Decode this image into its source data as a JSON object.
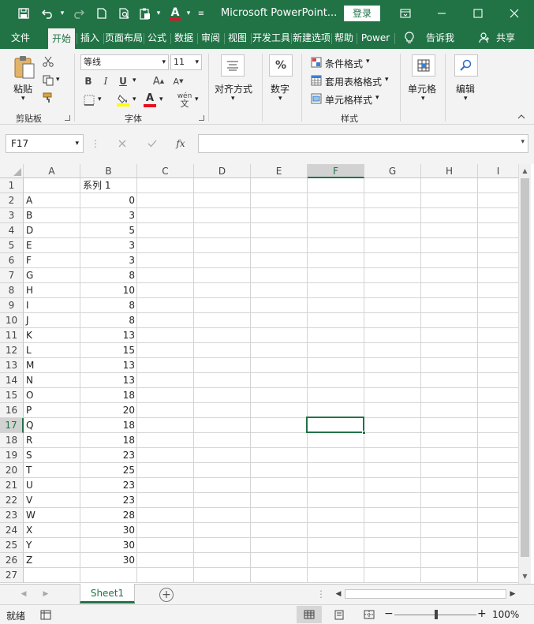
{
  "title_bar": {
    "title": "Microsoft PowerPoint...",
    "login": "登录",
    "qat_icons": [
      "save-icon",
      "undo-icon",
      "redo-icon",
      "new-doc-icon",
      "print-preview-icon",
      "paste-icon",
      "font-color-icon",
      "customize-icon"
    ],
    "window_icons": [
      "ribbon-display-icon",
      "minimize-icon",
      "maximize-icon",
      "close-icon"
    ]
  },
  "tabs": {
    "items": [
      "文件",
      "开始",
      "插入",
      "页面布局",
      "公式",
      "数据",
      "审阅",
      "视图",
      "开发工具",
      "新建选项卡",
      "帮助",
      "Power"
    ],
    "active": "开始",
    "tell_me": "告诉我",
    "share": "共享"
  },
  "ribbon": {
    "clipboard": {
      "paste": "粘贴",
      "label": "剪贴板"
    },
    "font": {
      "name": "等线",
      "size": "11",
      "bold": "B",
      "italic": "I",
      "underline": "U",
      "grow": "A",
      "shrink": "A",
      "wen": "wén",
      "font_color_letter": "A",
      "label": "字体"
    },
    "alignment": {
      "label": "对齐方式"
    },
    "number": {
      "label": "数字",
      "symbol": "%"
    },
    "styles": {
      "conditional": "条件格式",
      "table_format": "套用表格格式",
      "cell_style": "单元格样式",
      "label": "样式"
    },
    "cells": {
      "label": "单元格"
    },
    "editing": {
      "label": "编辑"
    }
  },
  "formula_bar": {
    "name_box": "F17",
    "fx": "fx",
    "content": ""
  },
  "grid": {
    "columns": [
      "A",
      "B",
      "C",
      "D",
      "E",
      "F",
      "G",
      "H",
      "I"
    ],
    "selected_column": "F",
    "selected_row": 17,
    "active_cell": "F17",
    "header_b1": "系列 1",
    "rows": [
      [
        "A",
        "0"
      ],
      [
        "B",
        "3"
      ],
      [
        "D",
        "5"
      ],
      [
        "E",
        "3"
      ],
      [
        "F",
        "3"
      ],
      [
        "G",
        "8"
      ],
      [
        "H",
        "10"
      ],
      [
        "I",
        "8"
      ],
      [
        "J",
        "8"
      ],
      [
        "K",
        "13"
      ],
      [
        "L",
        "15"
      ],
      [
        "M",
        "13"
      ],
      [
        "N",
        "13"
      ],
      [
        "O",
        "18"
      ],
      [
        "P",
        "20"
      ],
      [
        "Q",
        "18"
      ],
      [
        "R",
        "18"
      ],
      [
        "S",
        "23"
      ],
      [
        "T",
        "25"
      ],
      [
        "U",
        "23"
      ],
      [
        "V",
        "23"
      ],
      [
        "W",
        "28"
      ],
      [
        "X",
        "30"
      ],
      [
        "Y",
        "30"
      ],
      [
        "Z",
        "30"
      ]
    ],
    "row_numbers": [
      "1",
      "2",
      "3",
      "4",
      "5",
      "6",
      "7",
      "8",
      "9",
      "10",
      "11",
      "12",
      "13",
      "14",
      "15",
      "16",
      "17",
      "18",
      "19",
      "20",
      "21",
      "22",
      "23",
      "24",
      "25",
      "26",
      "27"
    ]
  },
  "sheets": {
    "tabs": [
      "Sheet1"
    ],
    "active": "Sheet1",
    "add": "+"
  },
  "status": {
    "ready": "就绪",
    "zoom": "100%",
    "zoom_minus": "−",
    "zoom_plus": "+"
  },
  "colors": {
    "accent": "#217346",
    "ribbon_bg": "#f3f3f3",
    "grid_line": "#d4d4d4"
  }
}
